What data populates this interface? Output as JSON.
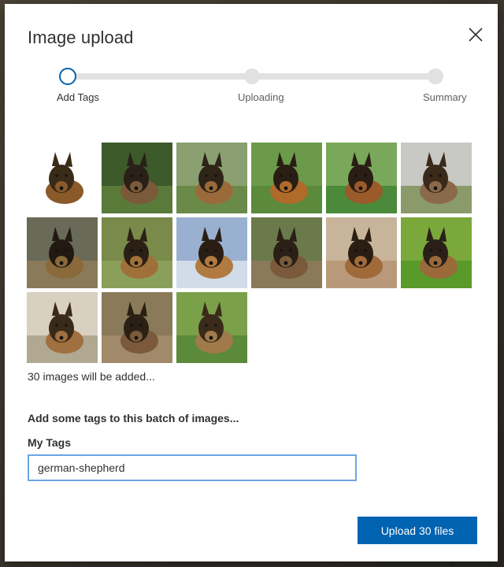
{
  "dialog": {
    "title": "Image upload",
    "close_icon": "close-icon"
  },
  "stepper": {
    "steps": [
      {
        "label": "Add Tags",
        "active": true
      },
      {
        "label": "Uploading",
        "active": false
      },
      {
        "label": "Summary",
        "active": false
      }
    ]
  },
  "gallery": {
    "thumbnails": [
      {
        "subject": "german-shepherd"
      },
      {
        "subject": "german-shepherd"
      },
      {
        "subject": "german-shepherd"
      },
      {
        "subject": "german-shepherd"
      },
      {
        "subject": "german-shepherd"
      },
      {
        "subject": "german-shepherd"
      },
      {
        "subject": "german-shepherd"
      },
      {
        "subject": "german-shepherd"
      },
      {
        "subject": "german-shepherd"
      },
      {
        "subject": "german-shepherd"
      },
      {
        "subject": "german-shepherd"
      },
      {
        "subject": "german-shepherd"
      },
      {
        "subject": "german-shepherd"
      },
      {
        "subject": "german-shepherd"
      },
      {
        "subject": "german-shepherd"
      }
    ],
    "count_text": "30 images will be added..."
  },
  "tags": {
    "heading": "Add some tags to this batch of images...",
    "label": "My Tags",
    "value": "german-shepherd"
  },
  "actions": {
    "upload_label": "Upload 30 files"
  },
  "colors": {
    "accent": "#0063b1",
    "track": "#e1e1e1",
    "input_border": "#6ba5e4"
  }
}
